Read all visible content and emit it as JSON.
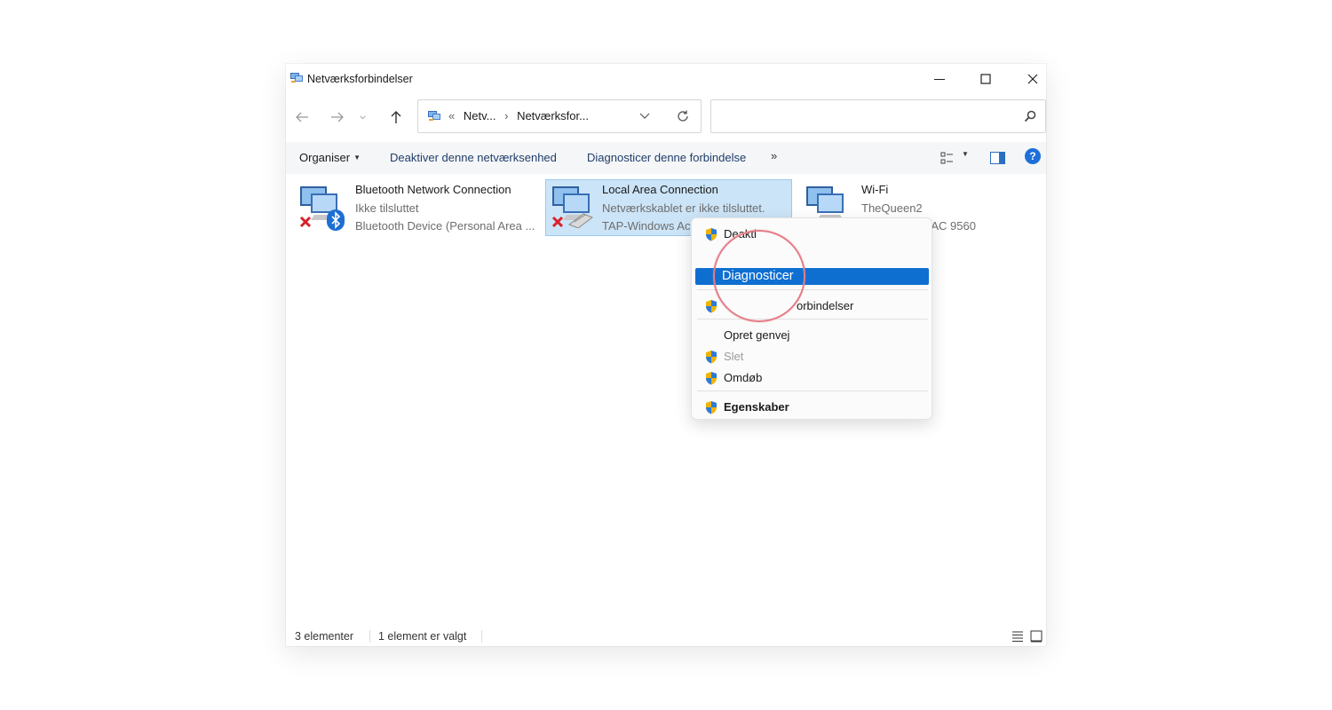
{
  "window": {
    "title": "Netværksforbindelser",
    "controls": {
      "minimize": "minimize-icon",
      "maximize": "maximize-icon",
      "close": "close-icon"
    }
  },
  "nav": {
    "back": "back-arrow-icon",
    "forward": "forward-arrow-icon",
    "recent": "chevron-down-icon",
    "up": "up-arrow-icon",
    "address": {
      "overflow": "«",
      "crumb1": "Netv...",
      "separator": "›",
      "crumb2": "Netværksfor..."
    },
    "search": {
      "placeholder": ""
    }
  },
  "toolbar": {
    "organise": "Organiser",
    "disable": "Deaktiver denne netværksenhed",
    "diagnose": "Diagnosticer denne forbindelse",
    "more": "»",
    "help": "?"
  },
  "connections": [
    {
      "name": "Bluetooth Network Connection",
      "status": "Ikke tilsluttet",
      "device": "Bluetooth Device (Personal Area ...",
      "selected": false
    },
    {
      "name": "Local Area Connection",
      "status": "Netværkskablet er ikke tilsluttet.",
      "device": "TAP-Windows Ac",
      "selected": true
    },
    {
      "name": "Wi-Fi",
      "status": "TheQueen2",
      "device": "-AC 9560",
      "selected": false
    }
  ],
  "context_menu": {
    "items": [
      {
        "label": "Deakti",
        "shield": true
      },
      {
        "label": "Diagnosticer",
        "highlighted": true
      },
      {
        "label": "orbindelser",
        "shield": true
      },
      {
        "label": "Opret genvej",
        "shield": false
      },
      {
        "label": "Slet",
        "shield": true,
        "disabled": true
      },
      {
        "label": "Omdøb",
        "shield": true
      },
      {
        "label": "Egenskaber",
        "shield": true,
        "bold": true
      }
    ]
  },
  "status": {
    "count": "3 elementer",
    "selection": "1 element er valgt"
  },
  "colors": {
    "accent": "#0f6fd1",
    "selection_bg": "#cce4f7",
    "focus_ring": "#e57d88"
  }
}
